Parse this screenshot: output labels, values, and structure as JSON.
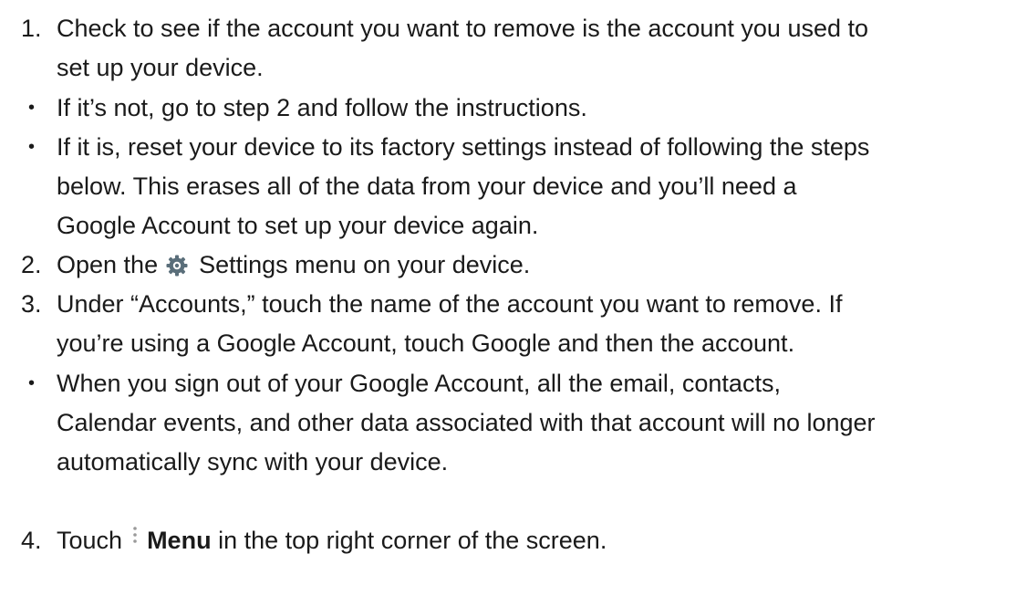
{
  "steps": {
    "s1": {
      "num": "1.",
      "line1": "Check to see if the account you want to remove is the account you used to",
      "line2": "set up your device."
    },
    "b1": {
      "bullet": "•",
      "text": "If it’s not, go to step 2 and follow the instructions."
    },
    "b2": {
      "bullet": "•",
      "line1": "If it is, reset your device to its factory settings instead of following the steps",
      "line2": "below. This erases all of the data from your device and you’ll need a",
      "line3": "Google Account to set up your device again."
    },
    "s2": {
      "num": "2.",
      "before": "Open the",
      "icon": "settings-gear-icon",
      "after": "Settings menu on your device."
    },
    "s3": {
      "num": "3.",
      "line1": "Under “Accounts,” touch the name of the account you want to remove. If",
      "line2": "you’re using a Google Account, touch Google and then the account."
    },
    "b3": {
      "bullet": "•",
      "line1": "When you sign out of your Google Account, all the email, contacts,",
      "line2": "Calendar events, and other data associated with that account will no longer",
      "line3": "automatically sync with your device."
    },
    "s4": {
      "num": "4.",
      "before": "Touch",
      "icon": "overflow-menu-icon",
      "bold": "Menu",
      "after": "in the top right corner of the screen."
    }
  },
  "colors": {
    "text": "#1a1a1a",
    "gear": "#5a6e7a",
    "menu": "#9a9a9a"
  }
}
